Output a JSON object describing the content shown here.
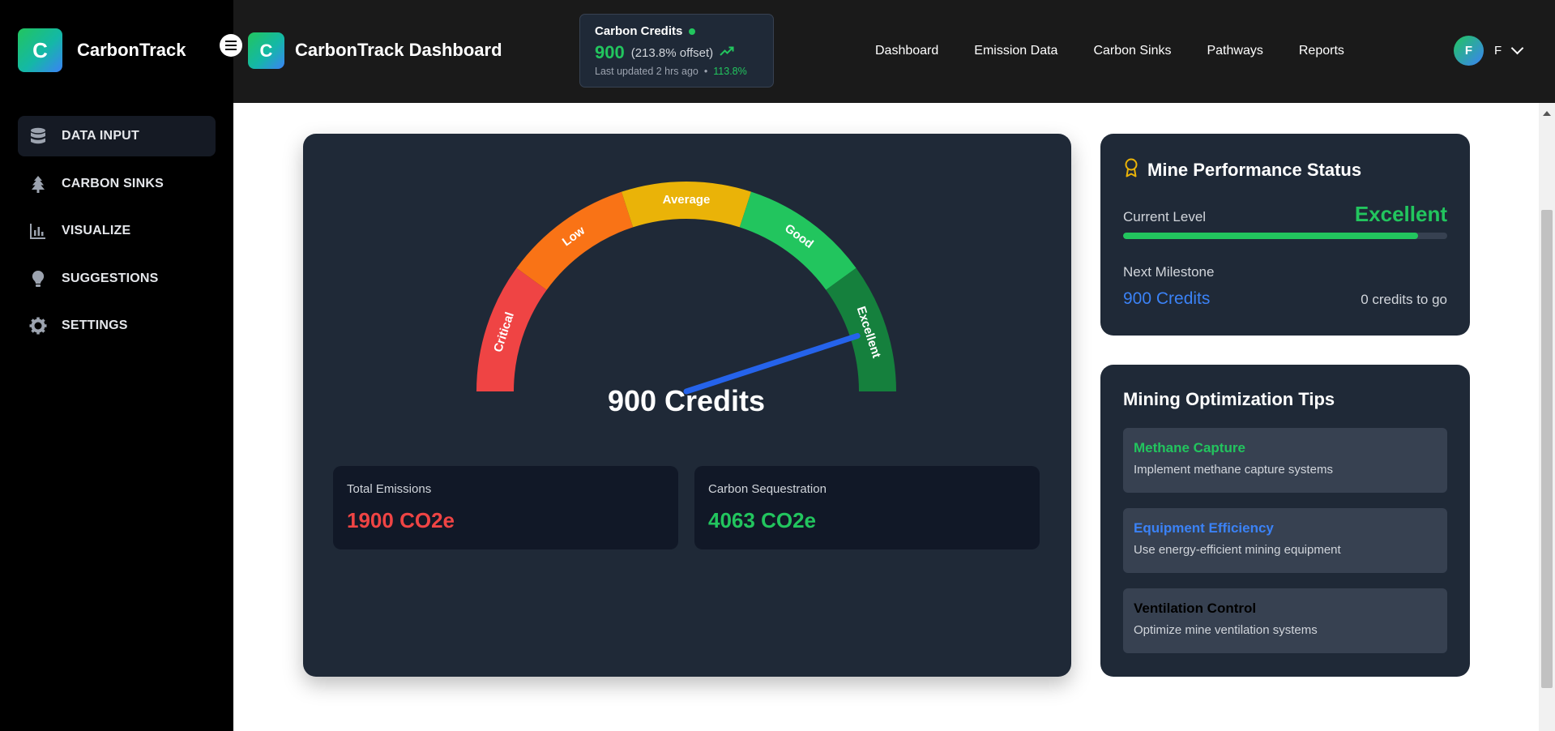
{
  "app": {
    "brand": "CarbonTrack",
    "logo_letter": "C"
  },
  "sidebar": {
    "items": [
      {
        "label": "DATA INPUT",
        "icon": "database-icon",
        "active": true
      },
      {
        "label": "CARBON SINKS",
        "icon": "tree-icon",
        "active": false
      },
      {
        "label": "VISUALIZE",
        "icon": "bar-chart-icon",
        "active": false
      },
      {
        "label": "SUGGESTIONS",
        "icon": "lightbulb-icon",
        "active": false
      },
      {
        "label": "SETTINGS",
        "icon": "gear-icon",
        "active": false
      }
    ]
  },
  "header": {
    "title": "CarbonTrack Dashboard",
    "logo_letter": "C",
    "credits_widget": {
      "title": "Carbon Credits",
      "value": "900",
      "offset": "(213.8% offset)",
      "updated": "Last updated 2 hrs ago",
      "separator": "•",
      "percent": "113.8%"
    },
    "nav": [
      "Dashboard",
      "Emission Data",
      "Carbon Sinks",
      "Pathways",
      "Reports"
    ],
    "user": {
      "avatar_letter": "F",
      "initial": "F"
    }
  },
  "gauge": {
    "value_label": "900 Credits",
    "needle_fraction": 0.9,
    "segments": [
      {
        "label": "Critical",
        "color": "#ef4444"
      },
      {
        "label": "Low",
        "color": "#f97316"
      },
      {
        "label": "Average",
        "color": "#eab308"
      },
      {
        "label": "Good",
        "color": "#22c55e"
      },
      {
        "label": "Excellent",
        "color": "#15803d"
      }
    ],
    "needle_color": "#2563eb"
  },
  "stats": {
    "emissions": {
      "label": "Total Emissions",
      "value": "1900 CO2e",
      "color": "#ef4444"
    },
    "sequestration": {
      "label": "Carbon Sequestration",
      "value": "4063 CO2e",
      "color": "#22c55e"
    }
  },
  "performance": {
    "title": "Mine Performance Status",
    "current_level_label": "Current Level",
    "current_level_value": "Excellent",
    "progress_fraction": 0.91,
    "next_milestone_label": "Next Milestone",
    "next_milestone_value": "900 Credits",
    "to_go": "0 credits to go"
  },
  "tips": {
    "title": "Mining Optimization Tips",
    "items": [
      {
        "title": "Methane Capture",
        "desc": "Implement methane capture systems",
        "color": "#22c55e"
      },
      {
        "title": "Equipment Efficiency",
        "desc": "Use energy-efficient mining equipment",
        "color": "#3b82f6"
      },
      {
        "title": "Ventilation Control",
        "desc": "Optimize mine ventilation systems",
        "color": "#000000"
      }
    ]
  }
}
